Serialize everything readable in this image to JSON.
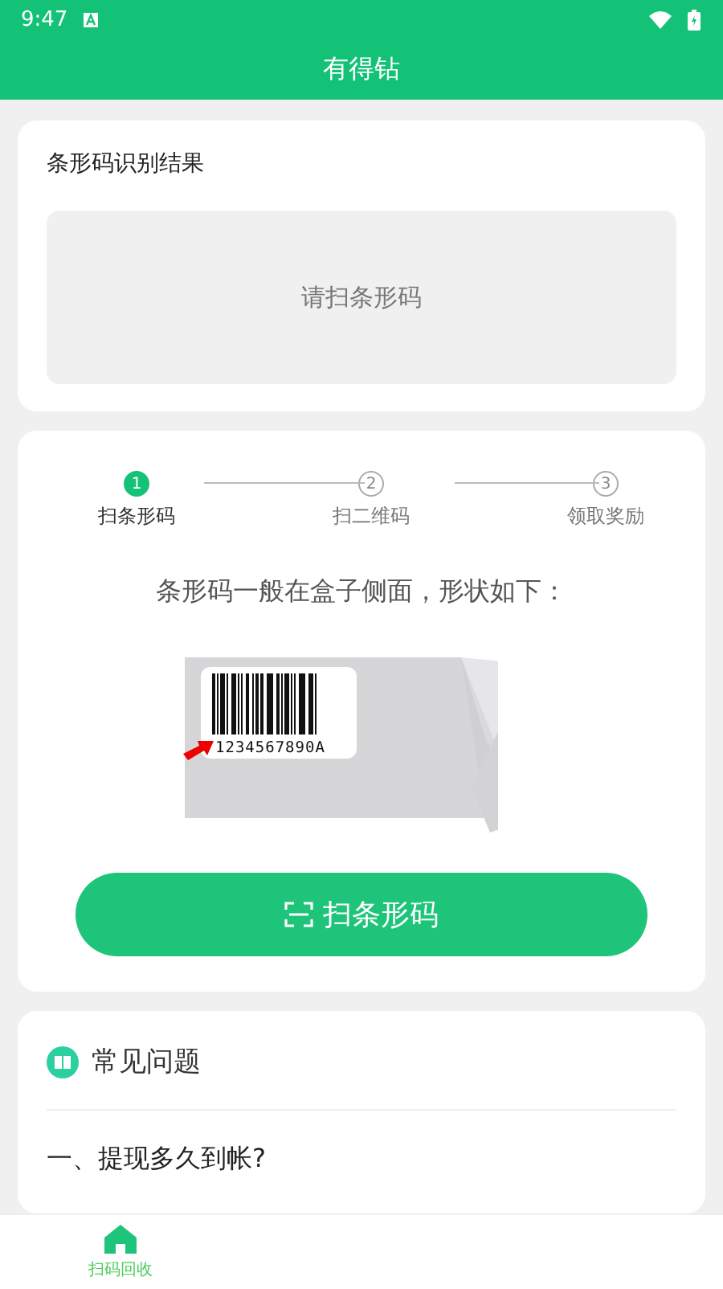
{
  "status_bar": {
    "time": "9:47"
  },
  "header": {
    "title": "有得钻"
  },
  "result_card": {
    "title": "条形码识别结果",
    "placeholder": "请扫条形码"
  },
  "steps": [
    {
      "number": "1",
      "label": "扫条形码",
      "selected": true
    },
    {
      "number": "2",
      "label": "扫二维码",
      "selected": false
    },
    {
      "number": "3",
      "label": "领取奖励",
      "selected": false
    }
  ],
  "hint": "条形码一般在盒子侧面，形状如下：",
  "barcode_digits": "1234567890A",
  "scan_button": {
    "label": "扫条形码"
  },
  "faq": {
    "title": "常见问题",
    "items": [
      "一、提现多久到帐?"
    ]
  },
  "bottom_nav": [
    {
      "label": "扫码回收",
      "selected": true
    }
  ]
}
